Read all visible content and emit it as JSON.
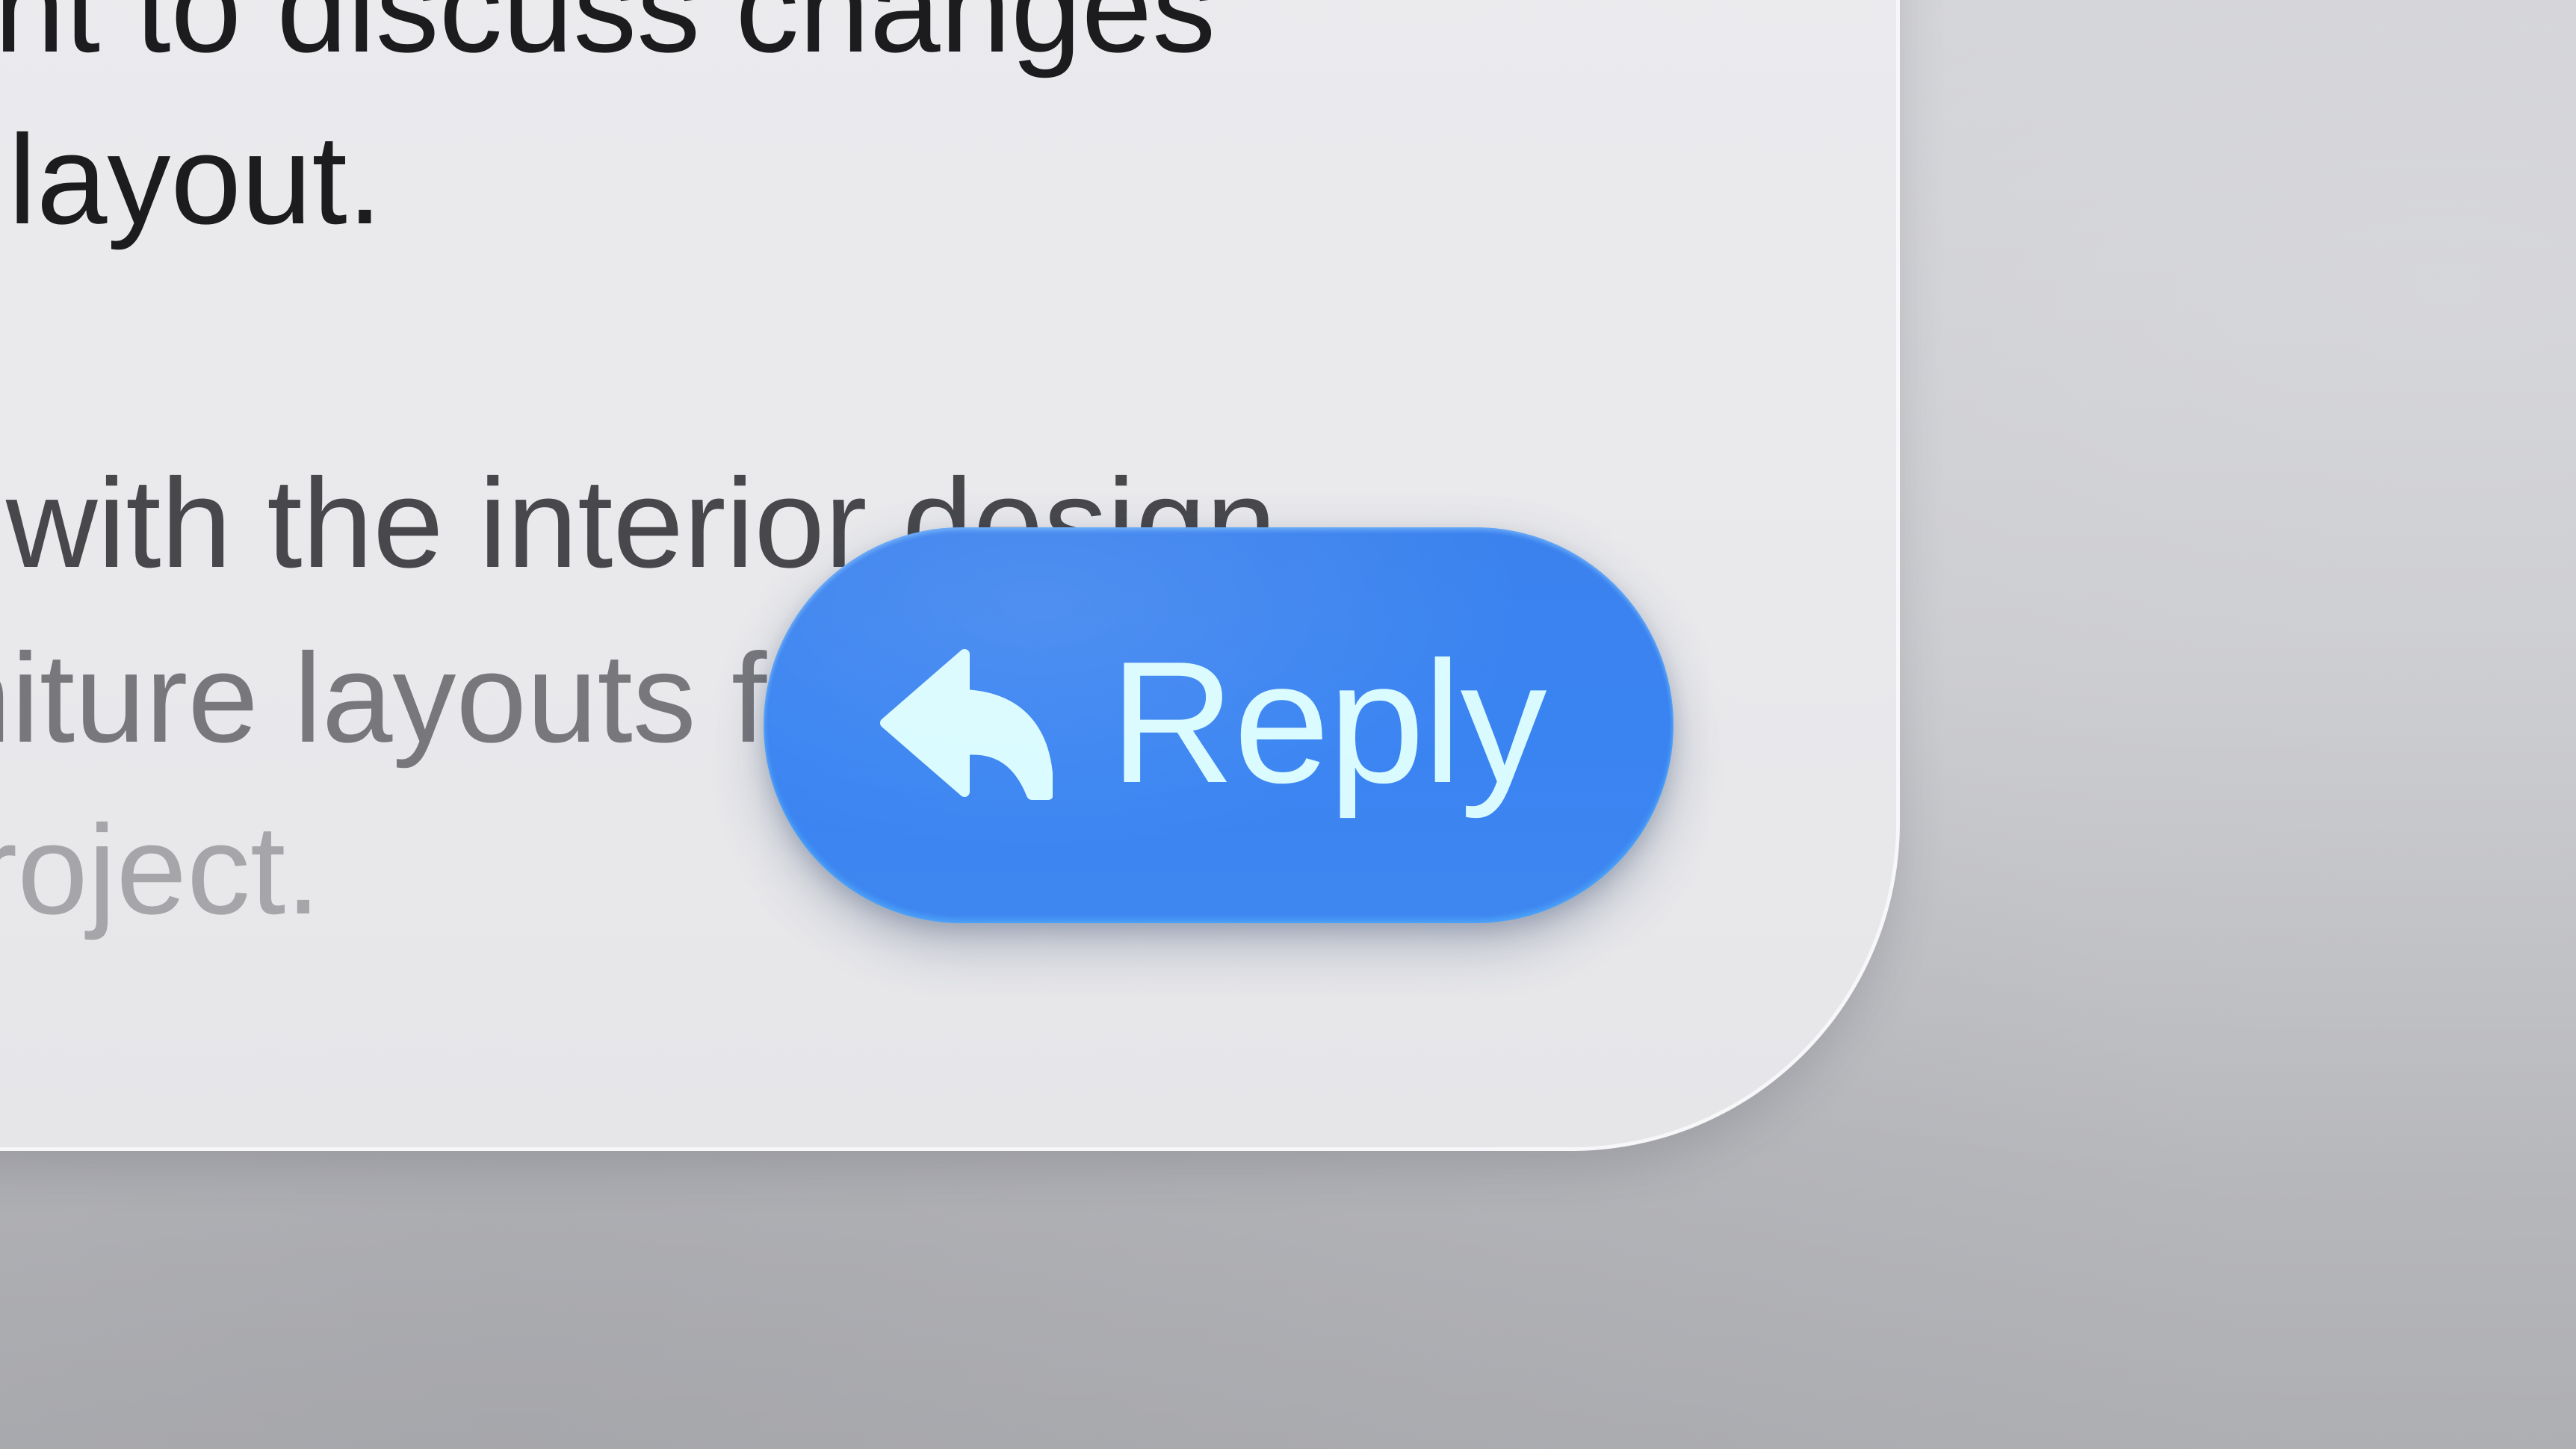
{
  "message": {
    "lines": [
      "ient to discuss changes",
      "rt layout.",
      "e with the interior design",
      "rniture layouts f",
      "project."
    ]
  },
  "reply_button": {
    "label": "Reply",
    "icon": "reply-arrow-icon",
    "color": "#3b82ee",
    "label_color": "#d9fbff"
  }
}
